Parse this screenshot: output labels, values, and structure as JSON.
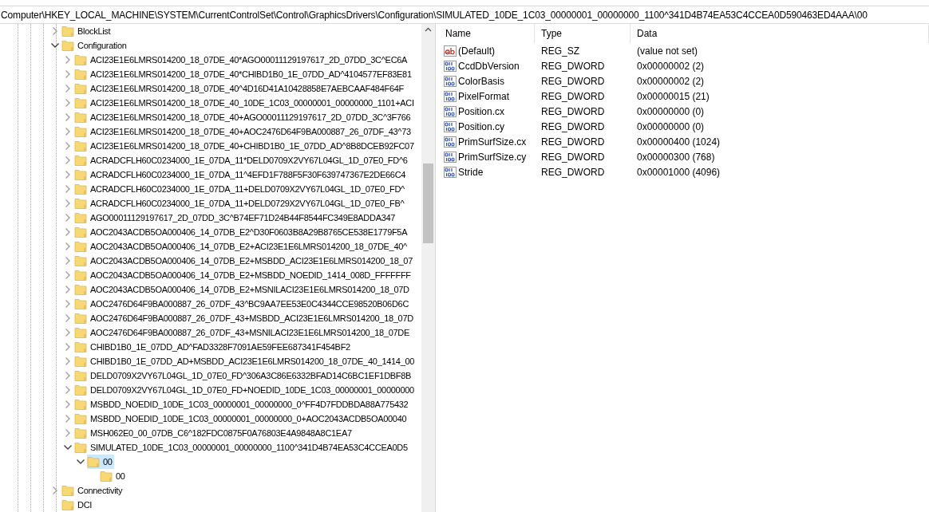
{
  "address_bar": {
    "value": "Computer\\HKEY_LOCAL_MACHINE\\SYSTEM\\CurrentControlSet\\Control\\GraphicsDrivers\\Configuration\\SIMULATED_10DE_1C03_00000001_00000000_1100^341D4B74EA53C4CCEA0D590463ED4AAA\\00"
  },
  "tree": {
    "items": [
      {
        "label": "BlockList",
        "has_children": true,
        "expanded": false,
        "selected": false
      },
      {
        "label": "Configuration",
        "has_children": true,
        "expanded": true,
        "selected": false,
        "children": [
          {
            "label": "ACI23E1E6LMRS014200_18_07DE_40*AGO00011129197617_2D_07DD_3C^EC6A",
            "has_children": true,
            "expanded": false,
            "selected": false
          },
          {
            "label": "ACI23E1E6LMRS014200_18_07DE_40*CHIBD1B0_1E_07DD_AD^4104577EF83E81",
            "has_children": true,
            "expanded": false,
            "selected": false
          },
          {
            "label": "ACI23E1E6LMRS014200_18_07DE_40^4D16D41A10428858E7AEBCAAF484F64F",
            "has_children": true,
            "expanded": false,
            "selected": false
          },
          {
            "label": "ACI23E1E6LMRS014200_18_07DE_40_10DE_1C03_00000001_00000000_1101+ACI",
            "has_children": true,
            "expanded": false,
            "selected": false
          },
          {
            "label": "ACI23E1E6LMRS014200_18_07DE_40+AGO00011129197617_2D_07DD_3C^3F766",
            "has_children": true,
            "expanded": false,
            "selected": false
          },
          {
            "label": "ACI23E1E6LMRS014200_18_07DE_40+AOC2476D64F9BA000887_26_07DF_43^73",
            "has_children": true,
            "expanded": false,
            "selected": false
          },
          {
            "label": "ACI23E1E6LMRS014200_18_07DE_40+CHIBD1B0_1E_07DD_AD^8B8DCEB92FC07",
            "has_children": true,
            "expanded": false,
            "selected": false
          },
          {
            "label": "ACRADCFLH60C0234000_1E_07DA_11*DELD0709X2VY67L04GL_1D_07E0_FD^6",
            "has_children": true,
            "expanded": false,
            "selected": false
          },
          {
            "label": "ACRADCFLH60C0234000_1E_07DA_11^4EFD1F788F5F30F639747367E2DE66C4",
            "has_children": true,
            "expanded": false,
            "selected": false
          },
          {
            "label": "ACRADCFLH60C0234000_1E_07DA_11+DELD0709X2VY67L04GL_1D_07E0_FD^",
            "has_children": true,
            "expanded": false,
            "selected": false
          },
          {
            "label": "ACRADCFLH60C0234000_1E_07DA_11+DELD0729X2VY67L04GL_1D_07E0_FB^",
            "has_children": true,
            "expanded": false,
            "selected": false
          },
          {
            "label": "AGO00011129197617_2D_07DD_3C^B74EF71D24B44F8544FC349E8ADDA347",
            "has_children": true,
            "expanded": false,
            "selected": false
          },
          {
            "label": "AOC2043ACDB5OA000406_14_07DB_E2^D30F0603B8A29B8765CE538E1779F5A",
            "has_children": true,
            "expanded": false,
            "selected": false
          },
          {
            "label": "AOC2043ACDB5OA000406_14_07DB_E2+ACI23E1E6LMRS014200_18_07DE_40^",
            "has_children": true,
            "expanded": false,
            "selected": false
          },
          {
            "label": "AOC2043ACDB5OA000406_14_07DB_E2+MSBDD_ACI23E1E6LMRS014200_18_07",
            "has_children": true,
            "expanded": false,
            "selected": false
          },
          {
            "label": "AOC2043ACDB5OA000406_14_07DB_E2+MSBDD_NOEDID_1414_008D_FFFFFFF",
            "has_children": true,
            "expanded": false,
            "selected": false
          },
          {
            "label": "AOC2043ACDB5OA000406_14_07DB_E2+MSNILACI23E1E6LMRS014200_18_07D",
            "has_children": true,
            "expanded": false,
            "selected": false
          },
          {
            "label": "AOC2476D64F9BA000887_26_07DF_43^BC9AA7EE53E0C4344CCE98520B06D6C",
            "has_children": true,
            "expanded": false,
            "selected": false
          },
          {
            "label": "AOC2476D64F9BA000887_26_07DF_43+MSBDD_ACI23E1E6LMRS014200_18_07D",
            "has_children": true,
            "expanded": false,
            "selected": false
          },
          {
            "label": "AOC2476D64F9BA000887_26_07DF_43+MSNILACI23E1E6LMRS014200_18_07DE",
            "has_children": true,
            "expanded": false,
            "selected": false
          },
          {
            "label": "CHIBD1B0_1E_07DD_AD^FAD3328F7091AE59FEE687341F454BF2",
            "has_children": true,
            "expanded": false,
            "selected": false
          },
          {
            "label": "CHIBD1B0_1E_07DD_AD+MSBDD_ACI23E1E6LMRS014200_18_07DE_40_1414_00",
            "has_children": true,
            "expanded": false,
            "selected": false
          },
          {
            "label": "DELD0709X2VY67L04GL_1D_07E0_FD^306A3C86E6332BFAD14C6BC1EF1DBF8B",
            "has_children": true,
            "expanded": false,
            "selected": false
          },
          {
            "label": "DELD0709X2VY67L04GL_1D_07E0_FD+NOEDID_10DE_1C03_00000001_00000000",
            "has_children": true,
            "expanded": false,
            "selected": false
          },
          {
            "label": "MSBDD_NOEDID_10DE_1C03_00000001_00000000_0^FF4D7FDDBDA88A775432",
            "has_children": true,
            "expanded": false,
            "selected": false
          },
          {
            "label": "MSBDD_NOEDID_10DE_1C03_00000001_00000000_0+AOC2043ACDB5OA00040",
            "has_children": true,
            "expanded": false,
            "selected": false
          },
          {
            "label": "MSH062E0_00_07DB_C6^182FDC0875F0A76803E4A9848A8C1EA7",
            "has_children": true,
            "expanded": false,
            "selected": false
          },
          {
            "label": "SIMULATED_10DE_1C03_00000001_00000000_1100^341D4B74EA53C4CCEA0D5",
            "has_children": true,
            "expanded": true,
            "selected": false,
            "children": [
              {
                "label": "00",
                "has_children": true,
                "expanded": true,
                "selected": true,
                "children": [
                  {
                    "label": "00",
                    "has_children": false,
                    "selected": false
                  }
                ]
              }
            ]
          }
        ]
      },
      {
        "label": "Connectivity",
        "has_children": true,
        "expanded": false,
        "selected": false
      },
      {
        "label": "DCI",
        "has_children": false,
        "selected": false
      }
    ]
  },
  "values": {
    "columns": [
      "Name",
      "Type",
      "Data"
    ],
    "rows": [
      {
        "kind": "string",
        "name": "(Default)",
        "type": "REG_SZ",
        "data": "(value not set)"
      },
      {
        "kind": "dword",
        "name": "CcdDbVersion",
        "type": "REG_DWORD",
        "data": "0x00000002 (2)"
      },
      {
        "kind": "dword",
        "name": "ColorBasis",
        "type": "REG_DWORD",
        "data": "0x00000002 (2)"
      },
      {
        "kind": "dword",
        "name": "PixelFormat",
        "type": "REG_DWORD",
        "data": "0x00000015 (21)"
      },
      {
        "kind": "dword",
        "name": "Position.cx",
        "type": "REG_DWORD",
        "data": "0x00000000 (0)"
      },
      {
        "kind": "dword",
        "name": "Position.cy",
        "type": "REG_DWORD",
        "data": "0x00000000 (0)"
      },
      {
        "kind": "dword",
        "name": "PrimSurfSize.cx",
        "type": "REG_DWORD",
        "data": "0x00000400 (1024)"
      },
      {
        "kind": "dword",
        "name": "PrimSurfSize.cy",
        "type": "REG_DWORD",
        "data": "0x00000300 (768)"
      },
      {
        "kind": "dword",
        "name": "Stride",
        "type": "REG_DWORD",
        "data": "0x00001000 (4096)"
      }
    ]
  }
}
